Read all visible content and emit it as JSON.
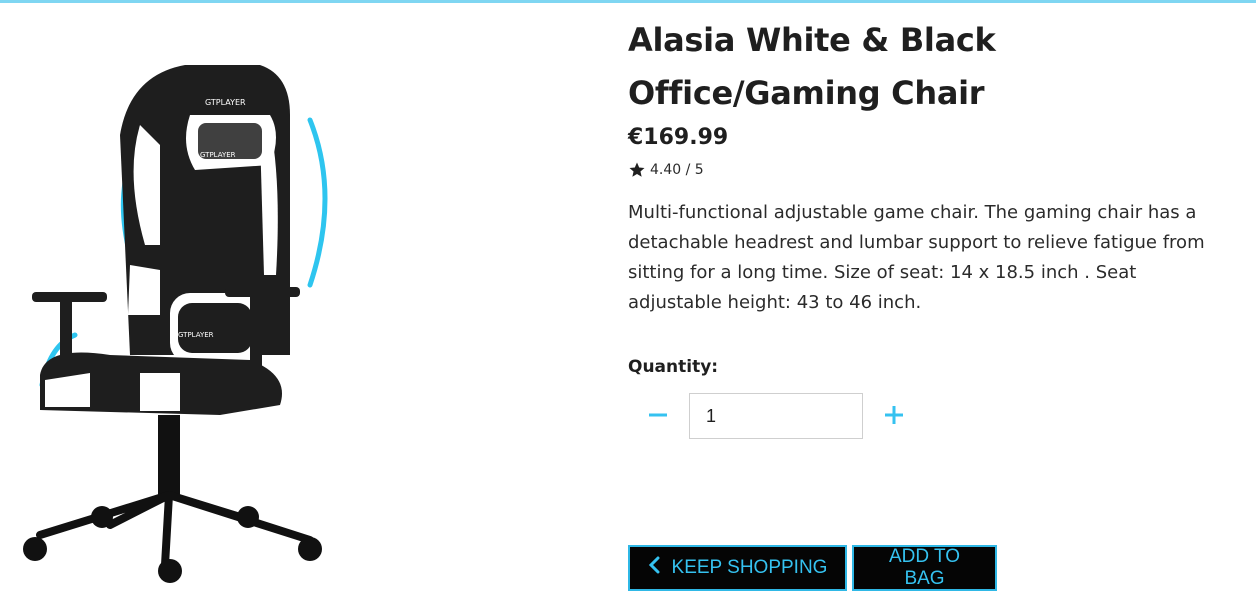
{
  "product": {
    "title": "Alasia White & Black Office/Gaming Chair",
    "price": "€169.99",
    "rating": "4.40 / 5",
    "description": "Multi-functional adjustable game chair. The gaming chair has a detachable headrest and lumbar support to relieve fatigue from sitting for a long time. Size of seat: 14 x 18.5 inch . Seat adjustable height: 43 to 46 inch.",
    "image_brand": "GTPLAYER",
    "image_icon": "gaming-chair-image"
  },
  "quantity": {
    "label": "Quantity:",
    "value": "1",
    "decrement_icon": "minus-icon",
    "increment_icon": "plus-icon"
  },
  "actions": {
    "keep_shopping": "KEEP SHOPPING",
    "add_to_bag": "ADD TO BAG"
  },
  "colors": {
    "accent": "#35c2f0",
    "button_bg": "#050505",
    "top_bar": "#7fd6f2"
  }
}
